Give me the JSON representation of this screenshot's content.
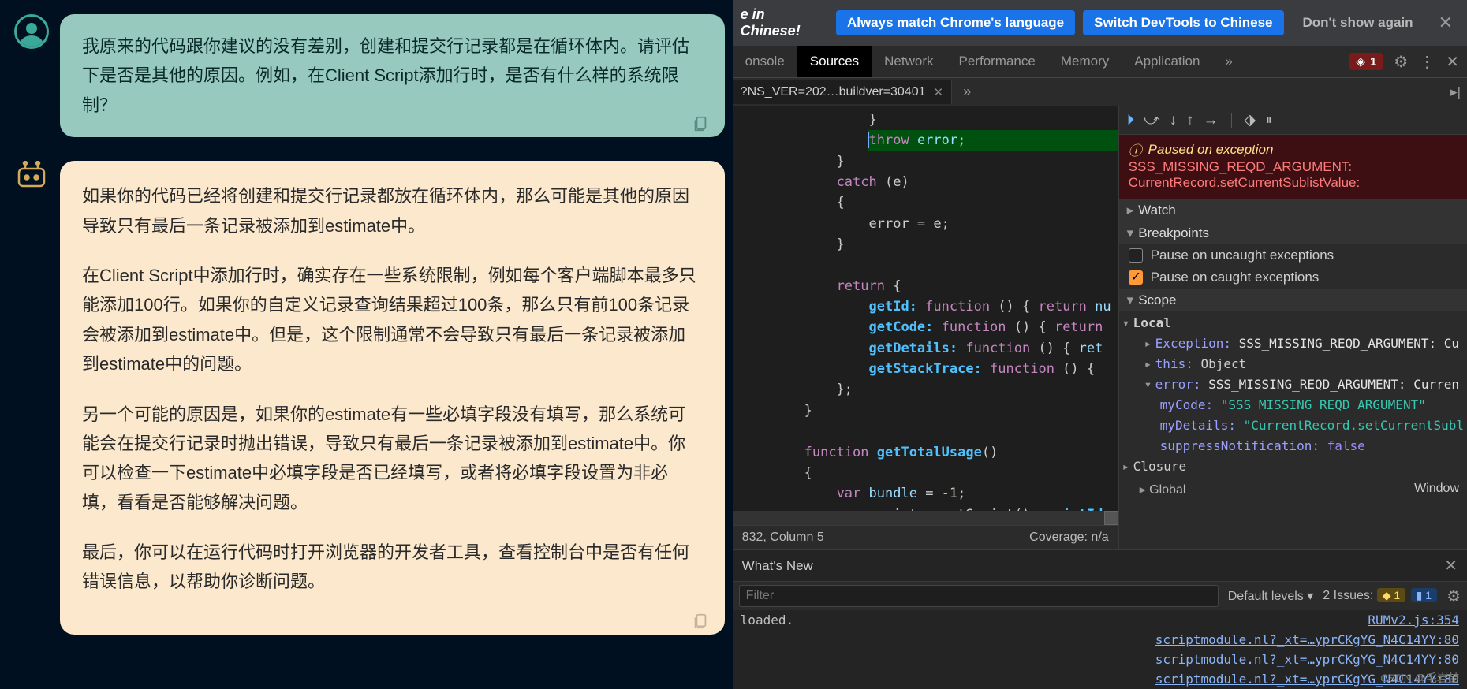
{
  "chat": {
    "user_msg": "我原来的代码跟你建议的没有差别，创建和提交行记录都是在循环体内。请评估下是否是其他的原因。例如，在Client Script添加行时，是否有什么样的系统限制？",
    "bot_msg": {
      "p1": "如果你的代码已经将创建和提交行记录都放在循环体内，那么可能是其他的原因导致只有最后一条记录被添加到estimate中。",
      "p2": "在Client Script中添加行时，确实存在一些系统限制，例如每个客户端脚本最多只能添加100行。如果你的自定义记录查询结果超过100条，那么只有前100条记录会被添加到estimate中。但是，这个限制通常不会导致只有最后一条记录被添加到estimate中的问题。",
      "p3": "另一个可能的原因是，如果你的estimate有一些必填字段没有填写，那么系统可能会在提交行记录时抛出错误，导致只有最后一条记录被添加到estimate中。你可以检查一下estimate中必填字段是否已经填写，或者将必填字段设置为非必填，看看是否能够解决问题。",
      "p4": "最后，你可以在运行代码时打开浏览器的开发者工具，查看控制台中是否有任何错误信息，以帮助你诊断问题。"
    }
  },
  "devtools": {
    "banner": {
      "prefix": "e in Chinese!",
      "btn1": "Always match Chrome's language",
      "btn2": "Switch DevTools to Chinese",
      "btn3": "Don't show again"
    },
    "tabs": [
      "onsole",
      "Sources",
      "Network",
      "Performance",
      "Memory",
      "Application"
    ],
    "active_tab": "Sources",
    "error_count": "1",
    "file_tab": "?NS_VER=202…buildver=30401",
    "code": {
      "line_throw": "throw",
      "line_error": "error",
      "line_catch": "catch",
      "line_e": "(e)",
      "line_err_assign": "error = e;",
      "line_return": "return",
      "line_getId": "getId:",
      "line_fnkw": "function",
      "line_rtn": "return",
      "line_getCode": "getCode:",
      "line_getDetails": "getDetails:",
      "line_getStack": "getStackTrace:",
      "line_fn_total": "getTotalUsage",
      "line_bundle": "bundle",
      "line_neg1": "-1",
      "line_getscript1": "var",
      "line_getscript2": "script = getScript()",
      "line_getscript3": "scriptId"
    },
    "status": {
      "pos": "832, Column 5",
      "cov": "Coverage: n/a"
    },
    "pause": {
      "title": "Paused on exception",
      "sub1": "SSS_MISSING_REQD_ARGUMENT:",
      "sub2": "CurrentRecord.setCurrentSublistValue:"
    },
    "sections": {
      "watch": "Watch",
      "break": "Breakpoints",
      "scope": "Scope",
      "local": "Local",
      "closure": "Closure",
      "global": "Global"
    },
    "break_opts": {
      "uncaught": "Pause on uncaught exceptions",
      "caught": "Pause on caught exceptions"
    },
    "scope": {
      "ex_key": "Exception:",
      "ex_val": "SSS_MISSING_REQD_ARGUMENT: Cu",
      "this_key": "this:",
      "this_val": "Object",
      "error_key": "error:",
      "error_val": "SSS_MISSING_REQD_ARGUMENT: Curren",
      "mycode_key": "myCode:",
      "mycode_val": "\"SSS_MISSING_REQD_ARGUMENT\"",
      "mydetails_key": "myDetails:",
      "mydetails_val": "\"CurrentRecord.setCurrentSubl",
      "suppress_key": "suppressNotification:",
      "suppress_val": "false",
      "window": "Window"
    },
    "whatsnew": "What's New",
    "filter_ph": "Filter",
    "levels": "Default levels ▾",
    "issues": "2 Issues:",
    "warn_n": "1",
    "msg_n": "1",
    "console_rows": [
      {
        "left": "loaded.",
        "right": "RUMv2.js:354"
      },
      {
        "left": "",
        "right": "scriptmodule.nl?_xt=…yprCKgYG_N4C14YY:80"
      },
      {
        "left": "",
        "right": "scriptmodule.nl?_xt=…yprCKgYG_N4C14YY:80"
      },
      {
        "left": "",
        "right": "scriptmodule.nl?_xt=…yprCKgYG_N4C14YY:80"
      }
    ]
  },
  "attrib": "CSDN @毛岩喆"
}
